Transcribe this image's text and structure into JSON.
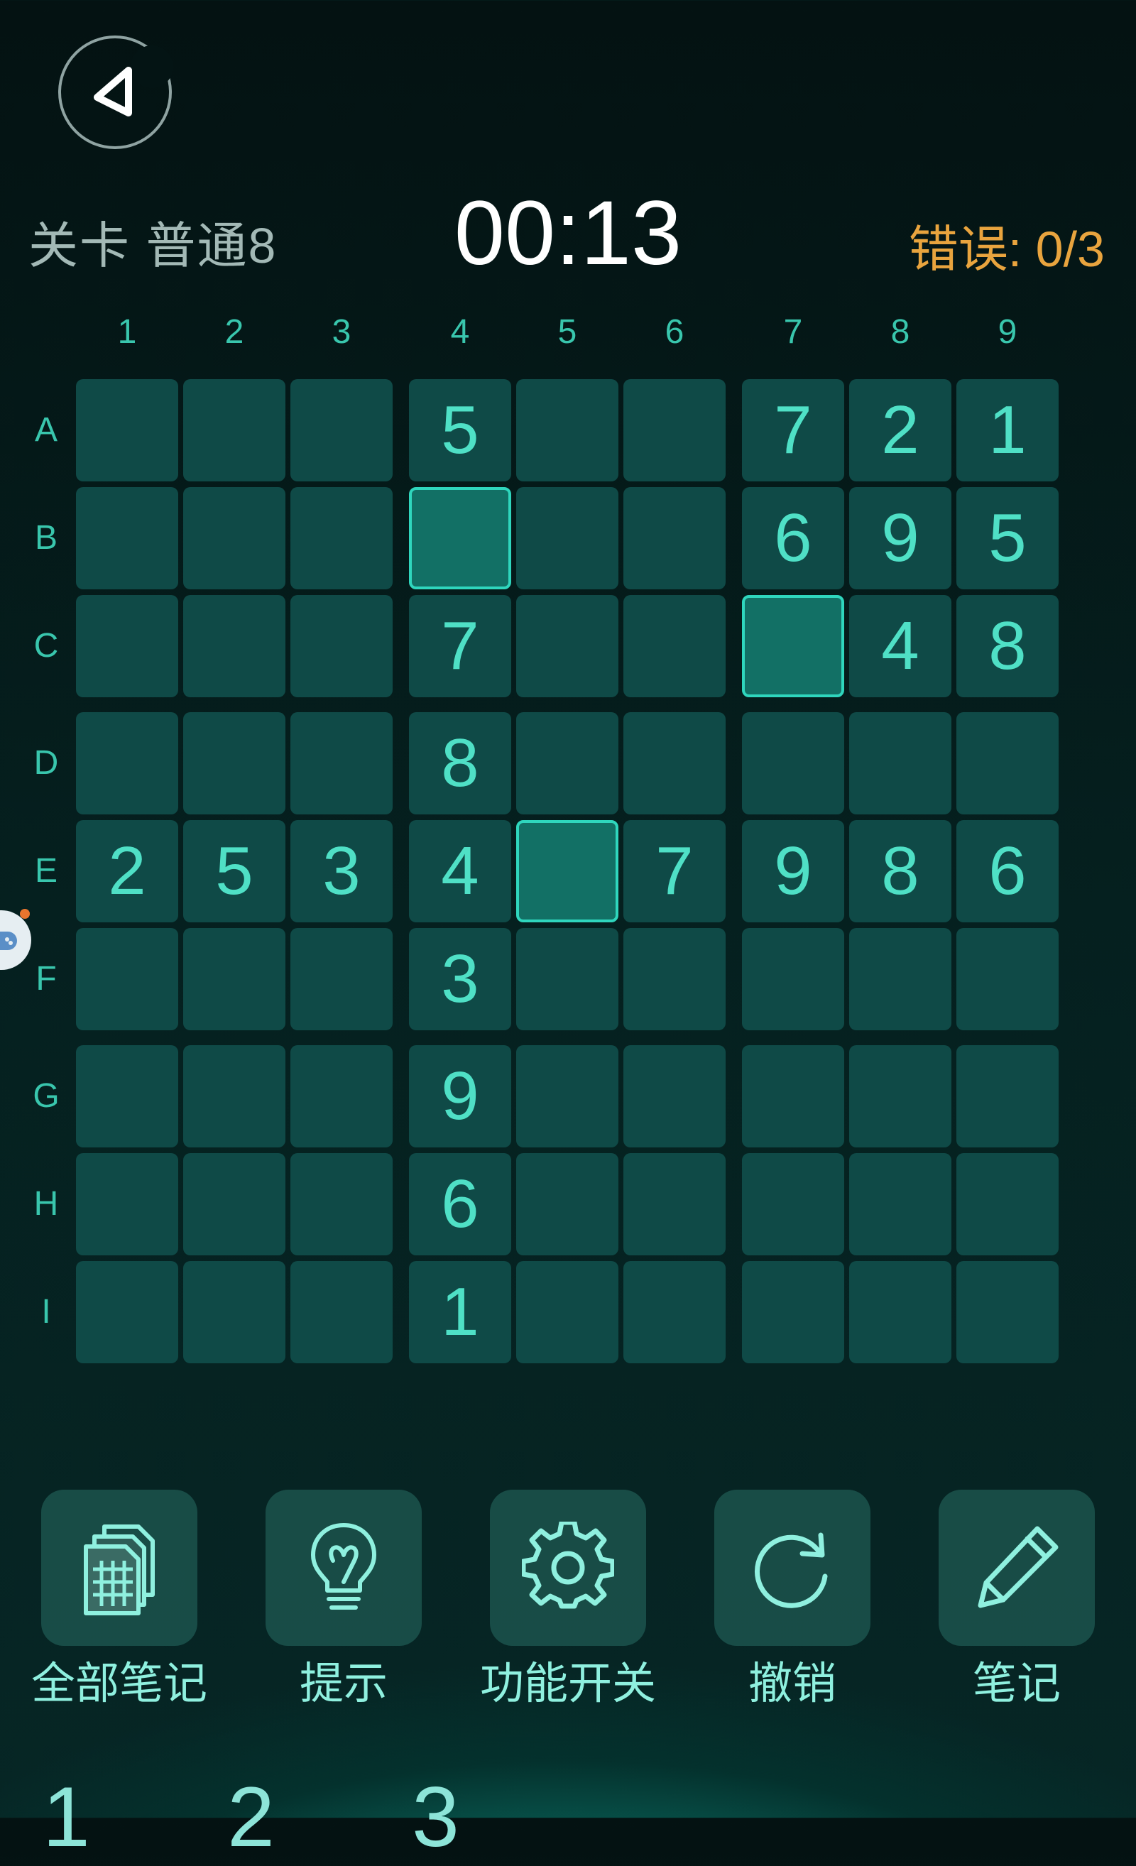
{
  "header": {
    "level": "关卡 普通8",
    "timer": "00:13",
    "errors": "错误: 0/3"
  },
  "columns": [
    "1",
    "2",
    "3",
    "4",
    "5",
    "6",
    "7",
    "8",
    "9"
  ],
  "rows": [
    "A",
    "B",
    "C",
    "D",
    "E",
    "F",
    "G",
    "H",
    "I"
  ],
  "grid": [
    [
      "",
      "",
      "",
      "5",
      "",
      "",
      "7",
      "2",
      "1"
    ],
    [
      "",
      "",
      "",
      "",
      "",
      "",
      "6",
      "9",
      "5"
    ],
    [
      "",
      "",
      "",
      "7",
      "",
      "",
      "",
      "4",
      "8"
    ],
    [
      "",
      "",
      "",
      "8",
      "",
      "",
      "",
      "",
      ""
    ],
    [
      "2",
      "5",
      "3",
      "4",
      "",
      "7",
      "9",
      "8",
      "6"
    ],
    [
      "",
      "",
      "",
      "3",
      "",
      "",
      "",
      "",
      ""
    ],
    [
      "",
      "",
      "",
      "9",
      "",
      "",
      "",
      "",
      ""
    ],
    [
      "",
      "",
      "",
      "6",
      "",
      "",
      "",
      "",
      ""
    ],
    [
      "",
      "",
      "",
      "1",
      "",
      "",
      "",
      "",
      ""
    ]
  ],
  "highlighted": [
    "B4",
    "C7",
    "E5"
  ],
  "toolbar": [
    {
      "label": "全部笔记",
      "icon": "all-notes-icon"
    },
    {
      "label": "提示",
      "icon": "lightbulb-icon"
    },
    {
      "label": "功能开关",
      "icon": "gear-icon"
    },
    {
      "label": "撤销",
      "icon": "undo-icon"
    },
    {
      "label": "笔记",
      "icon": "pencil-icon"
    }
  ],
  "bottom_digits": "1 2 3",
  "colors": {
    "accent": "#4fe0c6",
    "error": "#e9a43e",
    "cell": "#0f4a47",
    "cell_selected": "#127065"
  }
}
